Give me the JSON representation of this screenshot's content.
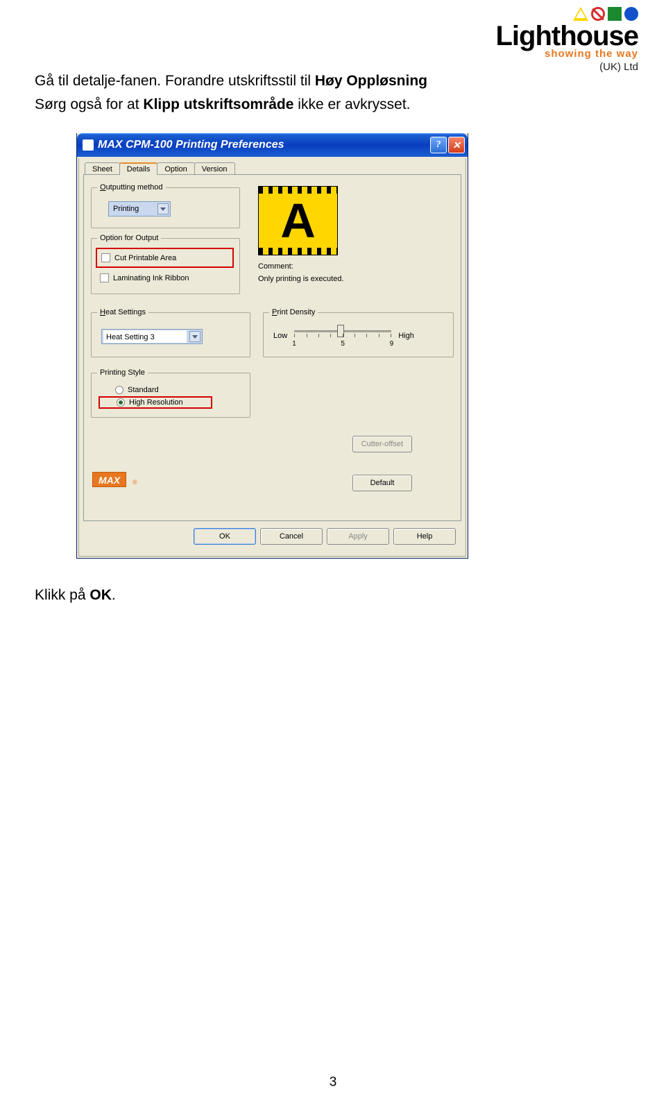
{
  "logo": {
    "name": "Lighthouse",
    "tagline": "showing the way",
    "country": "(UK) Ltd"
  },
  "doc": {
    "line1_a": "Gå til detalje-fanen.  Forandre utskriftsstil til ",
    "line1_b": "Høy Oppløsning",
    "line2_a": "Sørg også for at ",
    "line2_b": "Klipp utskriftsområde",
    "line2_c": " ikke er avkrysset.",
    "after_a": "Klikk på ",
    "after_b": "OK",
    "after_c": ".",
    "page": "3"
  },
  "dialog": {
    "title": "MAX CPM-100 Printing Preferences",
    "help_glyph": "?",
    "close_glyph": "✕",
    "tabs": {
      "sheet": "Sheet",
      "details": "Details",
      "option": "Option",
      "version": "Version"
    },
    "outputting": {
      "legend": "Outputting method",
      "dropdown": "Printing"
    },
    "option_output": {
      "legend": "Option for Output",
      "cut": "Cut Printable Area",
      "lam": "Laminating Ink Ribbon"
    },
    "preview_letter": "A",
    "comment_label": "Comment:",
    "comment_text": "Only printing is executed.",
    "heat": {
      "legend": "Heat Settings",
      "value": "Heat Setting 3"
    },
    "density": {
      "legend": "Print Density",
      "low": "Low",
      "high": "High",
      "n1": "1",
      "n5": "5",
      "n9": "9"
    },
    "style": {
      "legend": "Printing Style",
      "standard": "Standard",
      "highres": "High Resolution"
    },
    "cutter": "Cutter-offset",
    "default": "Default",
    "max": "MAX",
    "buttons": {
      "ok": "OK",
      "cancel": "Cancel",
      "apply": "Apply",
      "help": "Help"
    }
  }
}
